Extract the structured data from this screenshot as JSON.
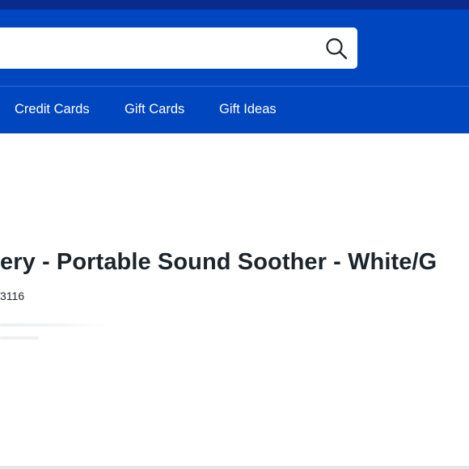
{
  "header": {
    "search": {
      "value": "",
      "placeholder": ""
    },
    "search_button_icon": "search-icon",
    "brand_color": "#0046be",
    "top_strip_color": "#0a2a8c"
  },
  "nav": {
    "items": [
      {
        "label": "Credit Cards"
      },
      {
        "label": "Gift Cards"
      },
      {
        "label": "Gift Ideas"
      }
    ]
  },
  "product": {
    "title": "ery - Portable Sound Soother - White/G",
    "sku_fragment": "3116"
  }
}
